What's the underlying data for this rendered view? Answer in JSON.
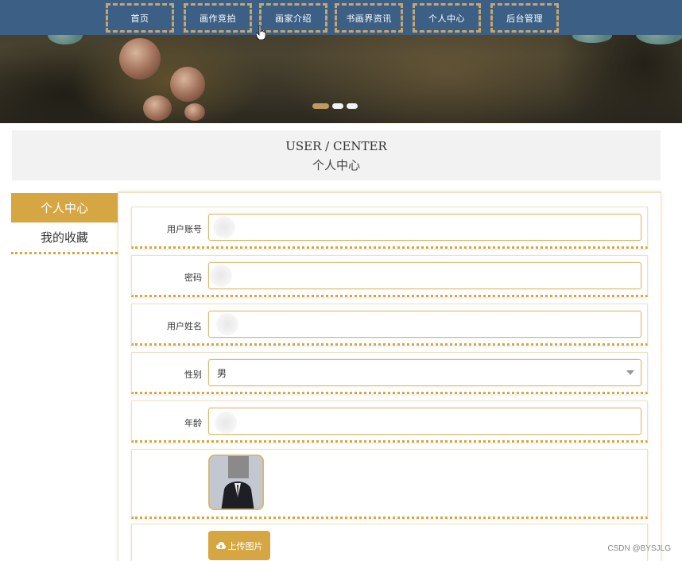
{
  "nav": {
    "items": [
      {
        "label": "首页"
      },
      {
        "label": "画作竞拍"
      },
      {
        "label": "画家介绍"
      },
      {
        "label": "书画界资讯"
      },
      {
        "label": "个人中心"
      },
      {
        "label": "后台管理"
      }
    ]
  },
  "carousel": {
    "slide_count": 3,
    "active_slide": 1
  },
  "page_title": {
    "en": "USER / CENTER",
    "cn": "个人中心"
  },
  "sidebar": {
    "header": "个人中心",
    "items": [
      {
        "label": "我的收藏"
      }
    ]
  },
  "form": {
    "account": {
      "label": "用户账号",
      "value": ""
    },
    "password": {
      "label": "密码",
      "value": ""
    },
    "name": {
      "label": "用户姓名",
      "value": ""
    },
    "gender": {
      "label": "性别",
      "value": "男"
    },
    "age": {
      "label": "年龄",
      "value": ""
    },
    "upload_label": "上传图片"
  },
  "watermark": "CSDN @BYSJLG",
  "colors": {
    "accent": "#d6a642",
    "nav_bg": "#3b5f85",
    "nav_border": "#c9a56b"
  }
}
